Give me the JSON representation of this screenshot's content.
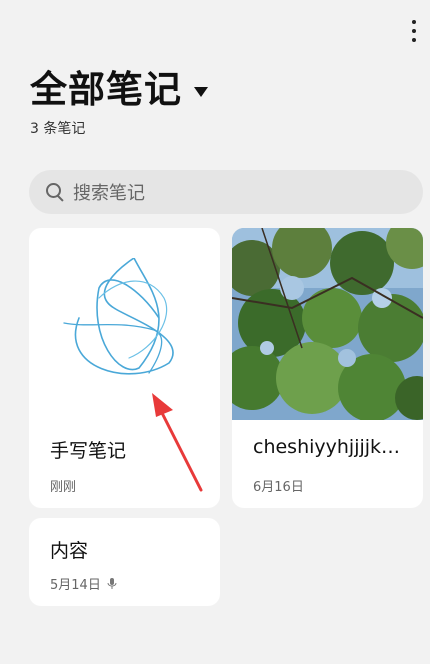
{
  "header": {
    "title": "全部笔记",
    "subtitle": "3 条笔记"
  },
  "search": {
    "placeholder": "搜索笔记"
  },
  "notes": [
    {
      "title": "手写笔记",
      "date": "刚刚"
    },
    {
      "title": "cheshiyyhjjjjkkk...",
      "date": "6月16日"
    },
    {
      "title": "内容",
      "date": "5月14日"
    }
  ],
  "colors": {
    "background": "#f2f2f2",
    "card": "#ffffff",
    "search_bg": "#e5e5e5",
    "sketch_stroke": "#4aa8d8",
    "arrow": "#e83a3a"
  },
  "icons": [
    "more-vertical-icon",
    "dropdown-caret-icon",
    "search-icon",
    "microphone-icon"
  ]
}
